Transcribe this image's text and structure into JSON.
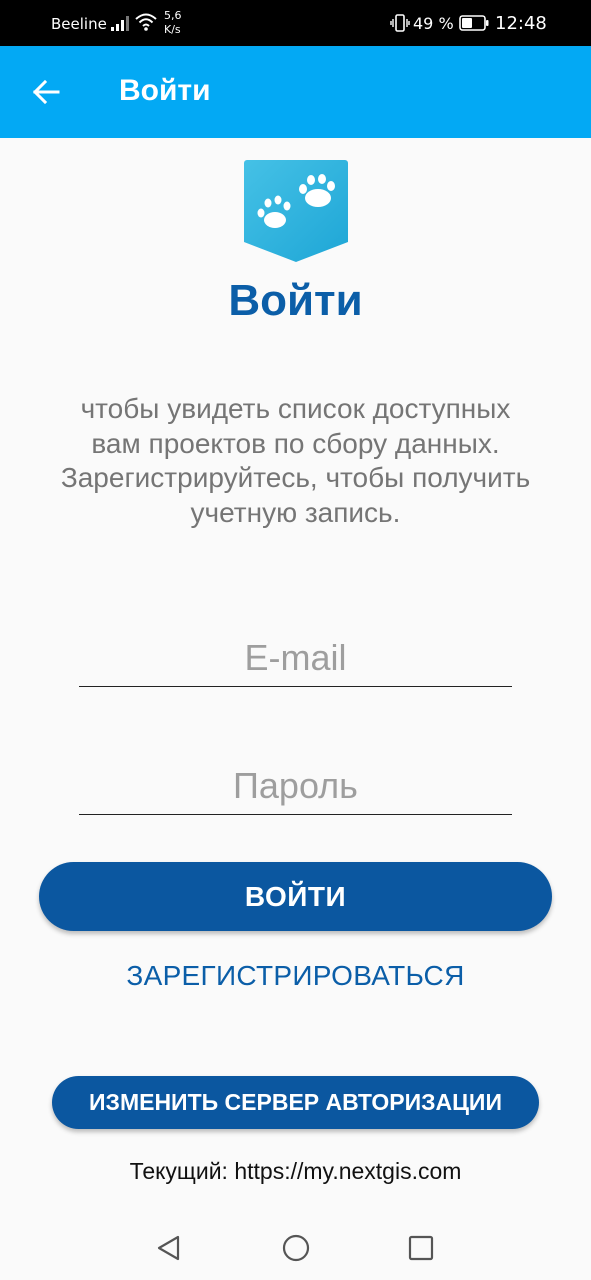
{
  "status_bar": {
    "carrier": "Beeline",
    "speed_value": "5,6",
    "speed_unit": "K/s",
    "battery_percent": "49 %",
    "time": "12:48",
    "icons": [
      "signal-icon",
      "wifi-icon",
      "vibrate-icon",
      "battery-icon"
    ]
  },
  "app_bar": {
    "title": "Войти",
    "back_icon": "arrow-left-icon",
    "color": "#03a9f4"
  },
  "main": {
    "logo_icon": "paw-prints-icon",
    "heading": "Войти",
    "description": "чтобы увидеть список доступных вам проектов по сбору данных. Зарегистрируйтесь, чтобы получить учетную запись.",
    "email": {
      "placeholder": "E-mail",
      "value": ""
    },
    "password": {
      "placeholder": "Пароль",
      "value": ""
    },
    "login_button": "ВОЙТИ",
    "register_link": "ЗАРЕГИСТРИРОВАТЬСЯ",
    "change_server_button": "ИЗМЕНИТЬ СЕРВЕР АВТОРИЗАЦИИ",
    "current_server": "Текущий: https://my.nextgis.com",
    "accent_color": "#0b57a0"
  },
  "nav_bar": {
    "icons": [
      "nav-back-icon",
      "nav-home-icon",
      "nav-recents-icon"
    ]
  }
}
